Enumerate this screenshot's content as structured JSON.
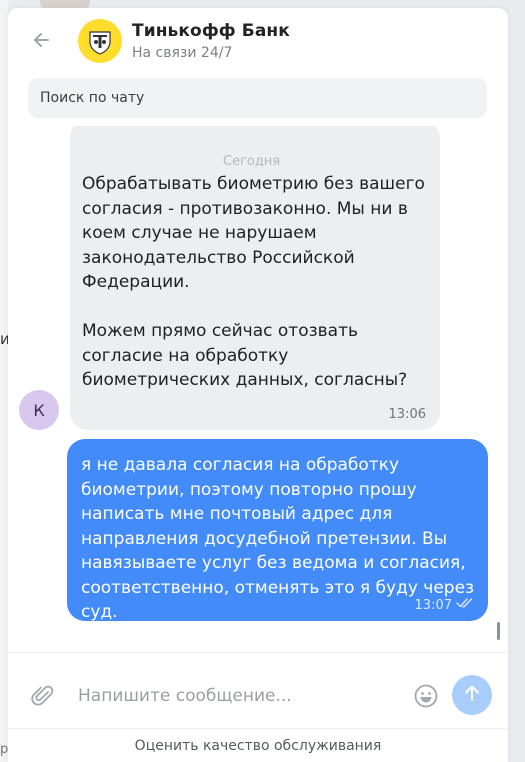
{
  "header": {
    "title": "Тинькофф Банк",
    "subtitle": "На связи 24/7",
    "back_icon": "arrow-left-icon",
    "logo_icon": "tinkoff-emblem-icon"
  },
  "search": {
    "placeholder": "Поиск по чату"
  },
  "chat": {
    "date_label": "Сегодня",
    "incoming": {
      "text": "Обрабатывать биометрию без вашего согласия - противозаконно. Мы ни в коем случае не нарушаем законодательство Российской Федерации.\n\nМожем прямо сейчас отозвать согласие на обработку биометрических данных, согласны?",
      "time": "13:06",
      "avatar_letter": "К"
    },
    "outgoing": {
      "text": "я не давала согласия на обработку биометрии, поэтому повторно прошу написать мне почтовый адрес для направления досудебной претензии. Вы навязываете услуг без ведома и согласия, соответственно, отменять это я буду через суд.",
      "time": "13:07",
      "status_icon": "double-check-icon"
    }
  },
  "composer": {
    "placeholder": "Напишите сообщение...",
    "attach_icon": "paperclip-icon",
    "emoji_icon": "emoji-icon",
    "send_icon": "arrow-up-icon"
  },
  "footer": {
    "rate_label": "Оценить качество обслуживания"
  },
  "colors": {
    "brand_yellow": "#ffdd2d",
    "outgoing_bubble": "#428bf9",
    "incoming_bubble": "#edeef1",
    "send_button": "#a9cdfb",
    "avatar_bg": "#d9c8ee"
  }
}
